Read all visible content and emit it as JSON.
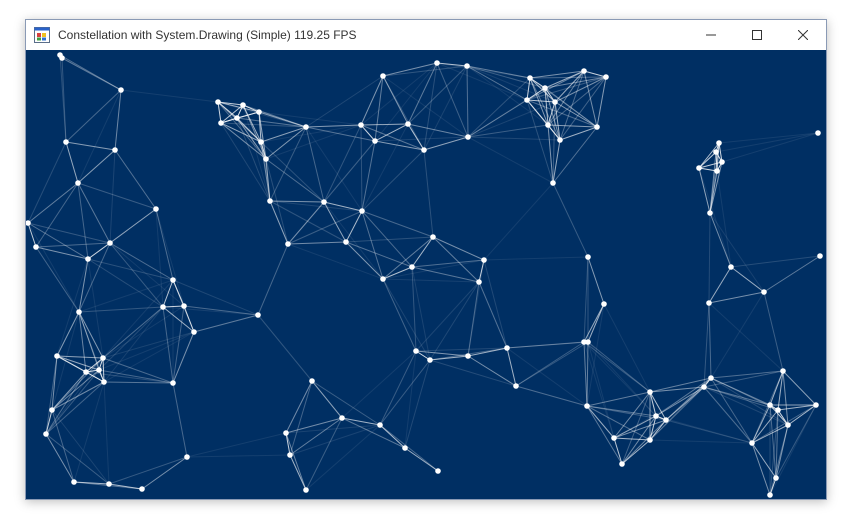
{
  "window": {
    "title": "Constellation with System.Drawing (Simple) 119.25 FPS",
    "icon": "windows-forms-app-icon",
    "controls": [
      "minimize-icon",
      "maximize-icon",
      "close-icon"
    ]
  },
  "canvas": {
    "background": "#002F63",
    "node_color": "#ffffff",
    "edge_color": "#ffffff"
  }
}
